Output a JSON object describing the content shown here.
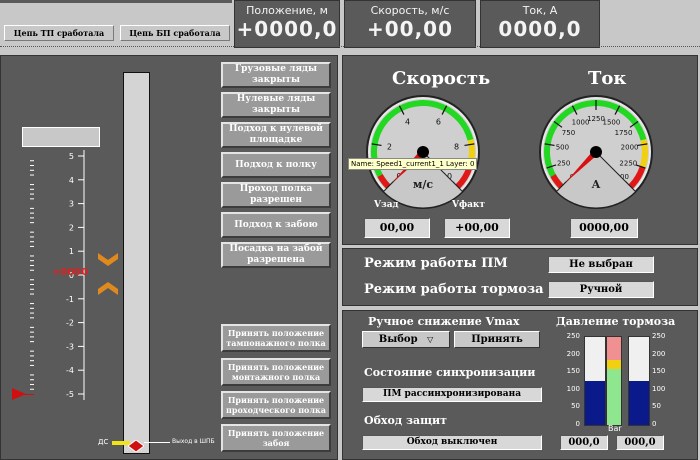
{
  "header": {
    "btn_tp": "Цепь ТП сработала",
    "btn_bp": "Цепь БП сработала",
    "position": {
      "label": "Положение, м",
      "value": "+0000,0"
    },
    "speed": {
      "label": "Скорость, м/с",
      "value": "+00,00"
    },
    "current": {
      "label": "Ток, А",
      "value": "0000,0"
    }
  },
  "left": {
    "scale_labels": [
      "5",
      "4",
      "3",
      "2",
      "1",
      "0",
      "-1",
      "-2",
      "-3",
      "-4",
      "-5"
    ],
    "position_readout": "+0000",
    "ds_label": "ДС",
    "ds_text": "Выход в ШПБ",
    "status_buttons": [
      "Грузовые ляды закрыты",
      "Нулевые ляды закрыты",
      "Подход к нулевой площадке",
      "Подход к полку",
      "Проход полка разрешен",
      "Подход к забою",
      "Посадка на забой разрешена"
    ],
    "accept_buttons": [
      "Принять положение тампонажного полка",
      "Принять положение монтажного полка",
      "Принять положение проходческого полка",
      "Принять положение забоя"
    ]
  },
  "gauges": {
    "speed": {
      "title": "Скорость",
      "unit": "м/с",
      "ticks": [
        "0",
        "2",
        "4",
        "6",
        "8",
        "10"
      ],
      "value": 0,
      "setpoint_label": "Vзад",
      "actual_label": "Vфакт",
      "setpoint_value": "00,00",
      "actual_value": "+00,00"
    },
    "current": {
      "title": "Ток",
      "unit": "А",
      "ticks": [
        "0",
        "250",
        "500",
        "750",
        "1000",
        "1250",
        "1500",
        "1750",
        "2000",
        "2250",
        "2500"
      ],
      "value": 0,
      "value_text": "0000,00"
    },
    "tooltip": "Name: Speed1_current1_1  Layer: 0"
  },
  "modes": {
    "pm_label": "Режим работы ПМ",
    "pm_value": "Не выбран",
    "brake_label": "Режим работы тормоза",
    "brake_value": "Ручной"
  },
  "bottom": {
    "vmax_label": "Ручное снижение Vmax",
    "select_value": "Выбор",
    "accept_label": "Принять",
    "sync_label": "Состояние синхронизации",
    "sync_value": "ПМ рассинхронизирована",
    "bypass_label": "Обход защит",
    "bypass_value": "Обход выключен",
    "pressure_title": "Давление тормоза",
    "pressure_ticks": [
      "250",
      "200",
      "150",
      "100",
      "50",
      "0"
    ],
    "bar_label": "Bar",
    "left_pressure": "000,0",
    "right_pressure": "000,0",
    "left_fill_fraction": 0.5,
    "right_fill_fraction": 0.5
  }
}
